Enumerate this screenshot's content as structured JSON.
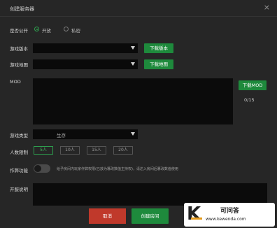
{
  "window": {
    "title": "创建服务器",
    "close_symbol": "×"
  },
  "form": {
    "public": {
      "label": "是否公开",
      "options": [
        "开放",
        "私密"
      ],
      "selected": "开放"
    },
    "version": {
      "label": "游戏版本",
      "value": "",
      "button": "下载版本"
    },
    "map": {
      "label": "游戏地图",
      "value": "",
      "button": "下载地图"
    },
    "mod": {
      "label": "MOD",
      "button": "下载MOD",
      "count": "0/15"
    },
    "game_type": {
      "label": "游戏类型",
      "value": "生存"
    },
    "players": {
      "label": "人数限制",
      "options": [
        "5人",
        "10人",
        "15人",
        "20人"
      ],
      "selected": "5人"
    },
    "cheat": {
      "label": "作弊功能",
      "enabled": false,
      "hint": "给予房间内玩家作弊权限(已放为篡改数值主持权)，请达入房间后篡改数值使用"
    },
    "description": {
      "label": "开服说明",
      "value": ""
    }
  },
  "actions": {
    "cancel": "取消",
    "create": "创建房间"
  },
  "watermark": {
    "logo": "K",
    "name": "可问答",
    "url": "www.kewenda.com"
  },
  "colors": {
    "accent": "#1e8a3c",
    "danger": "#c0392b",
    "background": "#262626"
  }
}
